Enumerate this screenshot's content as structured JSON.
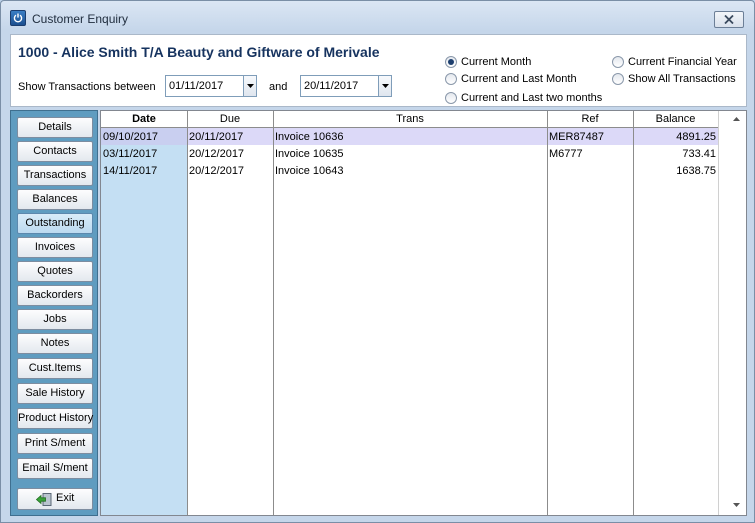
{
  "window": {
    "title": "Customer Enquiry"
  },
  "customer": {
    "heading": "1000 - Alice Smith T/A Beauty and Giftware of Merivale"
  },
  "range": {
    "label": "Show Transactions between",
    "from": "01/11/2017",
    "and_label": "and",
    "to": "20/11/2017"
  },
  "period_options": [
    {
      "label": "Current Month",
      "selected": true
    },
    {
      "label": "Current and Last Month",
      "selected": false
    },
    {
      "label": "Current and Last two months",
      "selected": false
    },
    {
      "label": "Current Financial Year",
      "selected": false
    },
    {
      "label": "Show All Transactions",
      "selected": false
    }
  ],
  "sidebar": {
    "items": [
      {
        "label": "Details"
      },
      {
        "label": "Contacts"
      },
      {
        "label": "Transactions"
      },
      {
        "label": "Balances"
      },
      {
        "label": "Outstanding",
        "active": true
      },
      {
        "label": "Invoices"
      },
      {
        "label": "Quotes"
      },
      {
        "label": "Backorders"
      },
      {
        "label": "Jobs"
      },
      {
        "label": "Notes"
      },
      {
        "label": "Cust.Items"
      },
      {
        "label": "Sale History"
      },
      {
        "label": "Product History"
      },
      {
        "label": "Print S/ment"
      },
      {
        "label": "Email S/ment"
      }
    ],
    "exit_label": "Exit"
  },
  "grid": {
    "columns": [
      "Date",
      "Due",
      "Trans",
      "Ref",
      "Balance"
    ],
    "rows": [
      {
        "date": "09/10/2017",
        "due": "20/11/2017",
        "trans": "Invoice 10636",
        "ref": "MER87487",
        "balance": "4891.25",
        "selected": true
      },
      {
        "date": "03/11/2017",
        "due": "20/12/2017",
        "trans": "Invoice 10635",
        "ref": "M6777",
        "balance": "733.41",
        "selected": false
      },
      {
        "date": "14/11/2017",
        "due": "20/12/2017",
        "trans": "Invoice 10643",
        "ref": "",
        "balance": "1638.75",
        "selected": false
      }
    ]
  },
  "colors": {
    "sidebar_bg": "#5f9cc0",
    "title_text": "#16335f",
    "date_column": "#c4dff3",
    "selected_row": "#dcd9f8"
  }
}
